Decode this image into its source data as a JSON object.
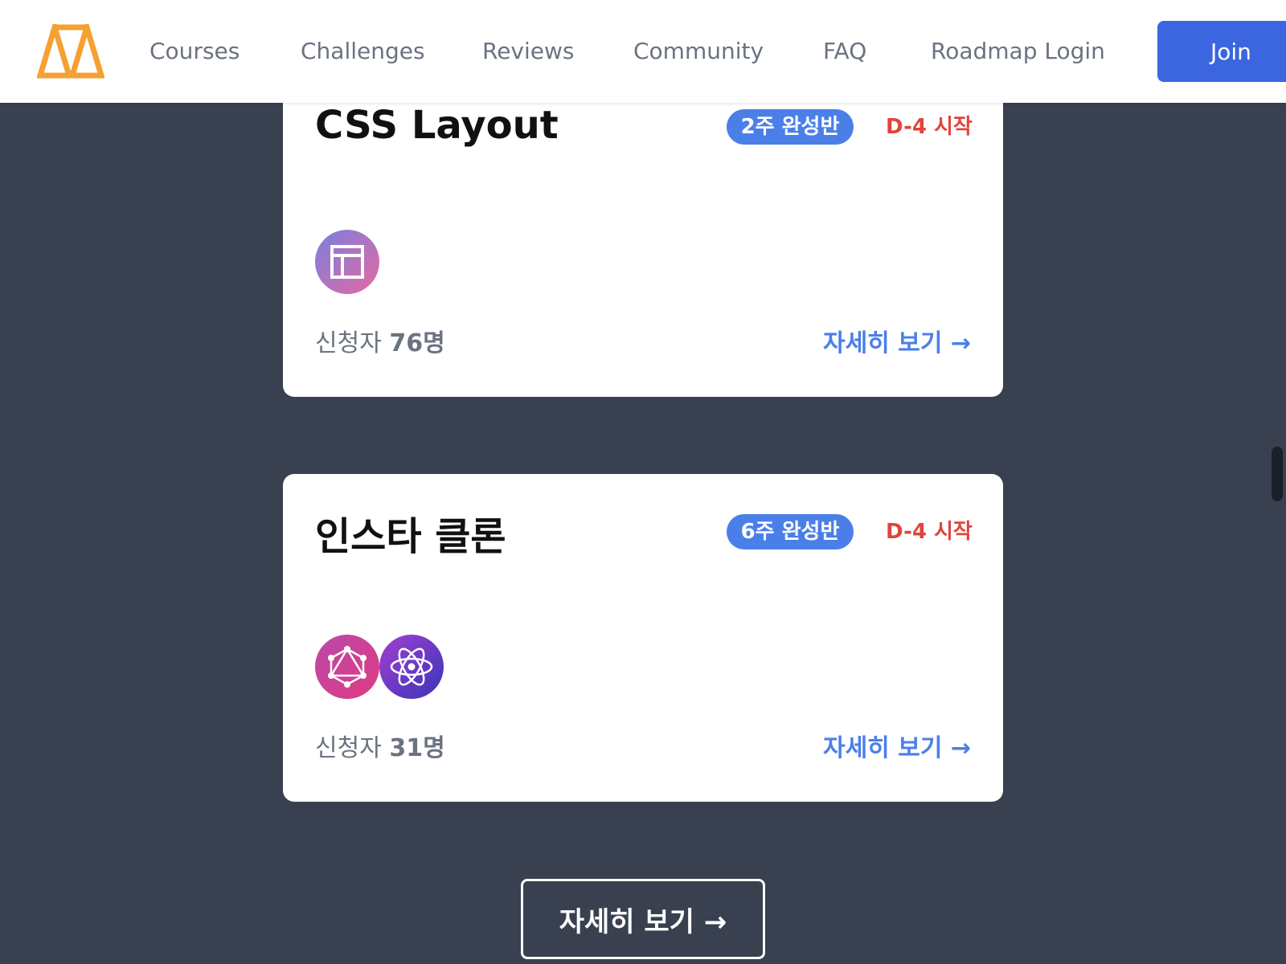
{
  "nav": {
    "logo_alt": "logo",
    "links": [
      "Courses",
      "Challenges",
      "Reviews",
      "Community",
      "FAQ",
      "Roadmap Login"
    ],
    "join_label": "Join"
  },
  "courses": [
    {
      "title": "CSS Layout",
      "badge": "2주 완성반",
      "start": "D-4 시작",
      "applicants_prefix": "신청자",
      "applicants_count": "76명",
      "detail": "자세히 보기 →",
      "icons": [
        "layout-icon"
      ]
    },
    {
      "title": "인스타 클론",
      "badge": "6주 완성반",
      "start": "D-4 시작",
      "applicants_prefix": "신청자",
      "applicants_count": "31명",
      "detail": "자세히 보기 →",
      "icons": [
        "graphql-icon",
        "react-icon"
      ]
    }
  ],
  "more_button": "자세히 보기 →",
  "colors": {
    "accent": "#4b7fe8",
    "join": "#3b66e0",
    "dday": "#e0443c",
    "background": "#394050",
    "logo": "#f5a033"
  }
}
